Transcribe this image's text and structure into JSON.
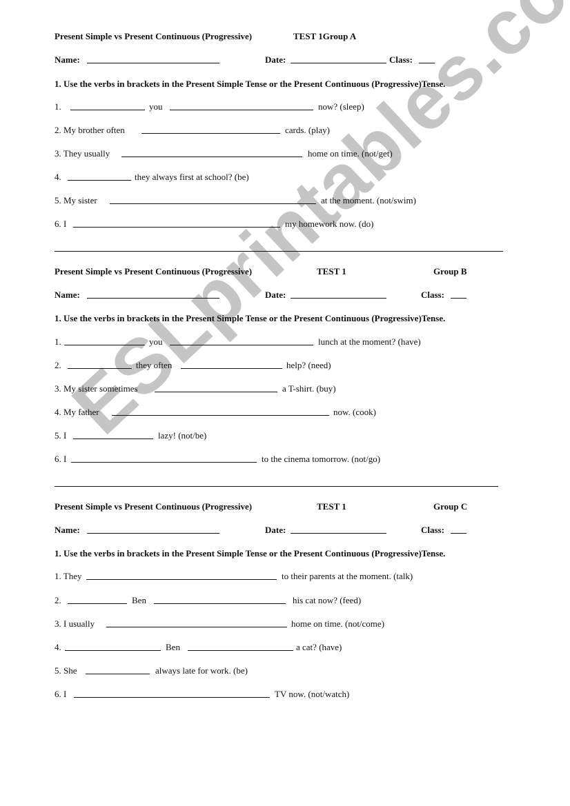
{
  "watermark": "ESLprintables.com",
  "sections": [
    {
      "group": "A",
      "title": "Present Simple vs Present Continuous (Progressive)",
      "test_label": "TEST  1Group  A",
      "test": "",
      "name_label": "Name:",
      "date_label": "Date:",
      "class_label": "Class:",
      "instruction": "1. Use the verbs in brackets in the Present Simple Tense or the Present Continuous (Progressive)Tense.",
      "items": [
        {
          "parts": [
            "1.",
            "you",
            "now?   (sleep)"
          ]
        },
        {
          "parts": [
            "2. My brother often",
            "cards.  (play)"
          ]
        },
        {
          "parts": [
            "3. They usually",
            "home  on time.  (not/get)"
          ]
        },
        {
          "parts": [
            "4.",
            "they always first at school?   (be)"
          ]
        },
        {
          "parts": [
            "5. My sister",
            "at the moment.  (not/swim)"
          ]
        },
        {
          "parts": [
            "6. I",
            "my homework now.  (do)"
          ]
        }
      ]
    },
    {
      "group": "B",
      "title": "Present Simple vs Present Continuous (Progressive)",
      "test": "TEST  1",
      "group_label": "Group  B",
      "name_label": "Name:",
      "date_label": "Date:",
      "class_label": "Class:",
      "instruction": "1. Use the verbs in brackets in the Present Simple Tense or the Present Continuous (Progressive)Tense.",
      "items": [
        {
          "parts": [
            "1.",
            "you",
            "lunch at the moment?  (have)"
          ]
        },
        {
          "parts": [
            "2.",
            "they often",
            "help?  (need)"
          ]
        },
        {
          "parts": [
            "3. My sister sometimes",
            "a T-shirt.  (buy)"
          ]
        },
        {
          "parts": [
            "4.  My father",
            "now.   (cook)"
          ]
        },
        {
          "parts": [
            "5. I",
            "lazy!   (not/be)"
          ]
        },
        {
          "parts": [
            "6. I",
            "to the cinema tomorrow.  (not/go)"
          ]
        }
      ]
    },
    {
      "group": "C",
      "title": "Present Simple vs Present Continuous (Progressive)",
      "test": "TEST  1",
      "group_label": "Group  C",
      "name_label": "Name:",
      "date_label": "Date:",
      "class_label": "Class:",
      "instruction": "1. Use the verbs in brackets in the Present Simple Tense or the Present Continuous (Progressive)Tense.",
      "items": [
        {
          "parts": [
            "1. They",
            "to their parents at the moment.  (talk)"
          ]
        },
        {
          "parts": [
            "2.",
            "Ben",
            "his cat now?  (feed)"
          ]
        },
        {
          "parts": [
            "3. I usually",
            "home on time. (not/come)"
          ]
        },
        {
          "parts": [
            "4.",
            "Ben",
            "a cat?  (have)"
          ]
        },
        {
          "parts": [
            "5. She",
            "always late for work. (be)"
          ]
        },
        {
          "parts": [
            "6. I",
            "TV now.  (not/watch)"
          ]
        }
      ]
    }
  ]
}
